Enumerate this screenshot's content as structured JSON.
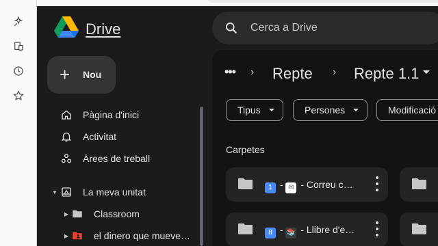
{
  "rail": {
    "icons": [
      "sparkle-pin-icon",
      "device-icon",
      "history-icon",
      "star-icon"
    ]
  },
  "header": {
    "brand": "Drive",
    "search_placeholder": "Cerca a Drive"
  },
  "nav": {
    "new_label": "Nou",
    "items": [
      {
        "label": "Pàgina d'inici",
        "icon": "home-icon"
      },
      {
        "label": "Activitat",
        "icon": "bell-icon"
      },
      {
        "label": "Àrees de treball",
        "icon": "workspaces-icon"
      }
    ],
    "my_drive": {
      "label": "La meva unitat",
      "icon": "my-drive-icon"
    },
    "subfolders": [
      {
        "label": "Classroom",
        "icon": "folder-icon",
        "color": "#c4c7c5"
      },
      {
        "label": "el dinero que mueve…",
        "icon": "shared-folder-icon",
        "color": "#e94235"
      }
    ]
  },
  "breadcrumb": {
    "more": "•••",
    "items": [
      "Repte",
      "Repte 1.1"
    ]
  },
  "filters": [
    "Tipus",
    "Persones",
    "Modificació"
  ],
  "section_title": "Carpetes",
  "folders": [
    {
      "badge": "1️⃣",
      "badge_text": "1",
      "emoji": "✉️",
      "emoji_text": "✉",
      "title": " - Correu c…"
    },
    {
      "badge": "8️⃣",
      "badge_text": "8",
      "emoji": "📚",
      "emoji_text": "📚",
      "title": " - Llibre d'e…"
    }
  ],
  "colors": {
    "accent_blue": "#1a73e8",
    "folder_grey": "#c4c7c5",
    "shared_red": "#e94235"
  }
}
